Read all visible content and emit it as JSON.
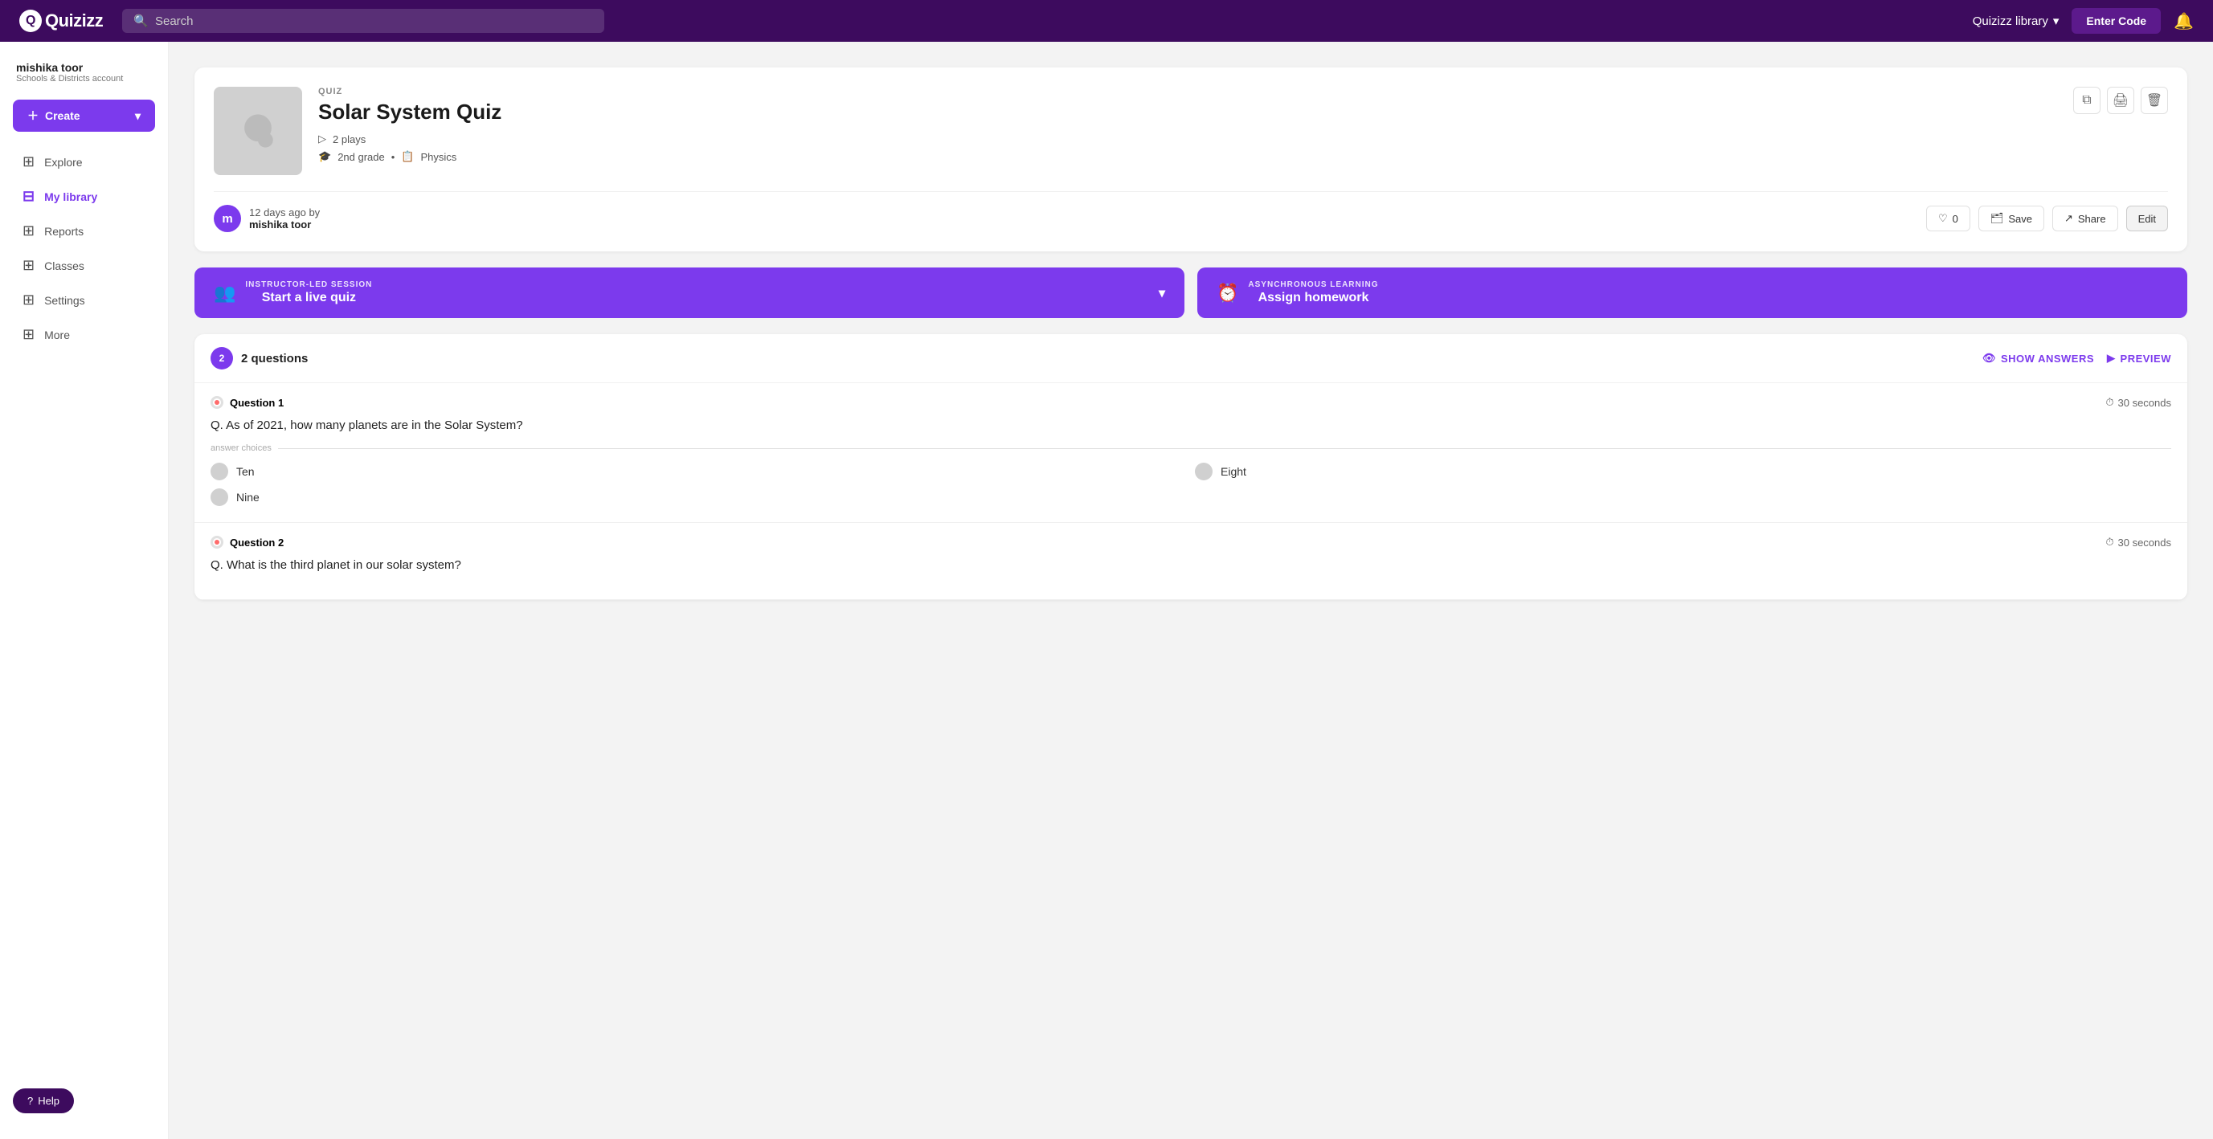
{
  "topnav": {
    "logo_text": "Quizizz",
    "search_placeholder": "Search",
    "library_label": "Quizizz library",
    "enter_code_label": "Enter Code"
  },
  "sidebar": {
    "user_name": "mishika toor",
    "user_account": "Schools & Districts account",
    "create_label": "Create",
    "nav_items": [
      {
        "id": "explore",
        "label": "Explore",
        "icon": "⊞"
      },
      {
        "id": "my-library",
        "label": "My library",
        "icon": "⊟",
        "active": true
      },
      {
        "id": "reports",
        "label": "Reports",
        "icon": "⊞"
      },
      {
        "id": "classes",
        "label": "Classes",
        "icon": "⊞"
      },
      {
        "id": "settings",
        "label": "Settings",
        "icon": "⊞"
      },
      {
        "id": "more",
        "label": "More",
        "icon": "⊞"
      }
    ],
    "help_label": "Help"
  },
  "quiz": {
    "type_label": "QUIZ",
    "title": "Solar System Quiz",
    "plays_label": "2 plays",
    "grade_label": "2nd grade",
    "subject_label": "Physics",
    "author_time": "12 days ago by",
    "author_name": "mishika toor",
    "author_initial": "m",
    "like_count": "0",
    "like_label": "0",
    "save_label": "Save",
    "share_label": "Share",
    "edit_label": "Edit"
  },
  "live_quiz": {
    "sub_label": "INSTRUCTOR-LED SESSION",
    "main_label": "Start a live quiz"
  },
  "homework": {
    "sub_label": "ASYNCHRONOUS LEARNING",
    "main_label": "Assign homework"
  },
  "questions": {
    "count": "2",
    "count_text": "2 questions",
    "show_answers_label": "SHOW ANSWERS",
    "preview_label": "PREVIEW",
    "items": [
      {
        "id": "q1",
        "label": "Question 1",
        "time": "30 seconds",
        "text": "Q. As of 2021, how many planets are in the Solar System?",
        "choices_label": "answer choices",
        "choices": [
          {
            "id": "c1",
            "text": "Ten"
          },
          {
            "id": "c2",
            "text": "Eight"
          },
          {
            "id": "c3",
            "text": "Nine"
          }
        ]
      },
      {
        "id": "q2",
        "label": "Question 2",
        "time": "30 seconds",
        "text": "Q. What is the third planet in our solar system?"
      }
    ]
  }
}
